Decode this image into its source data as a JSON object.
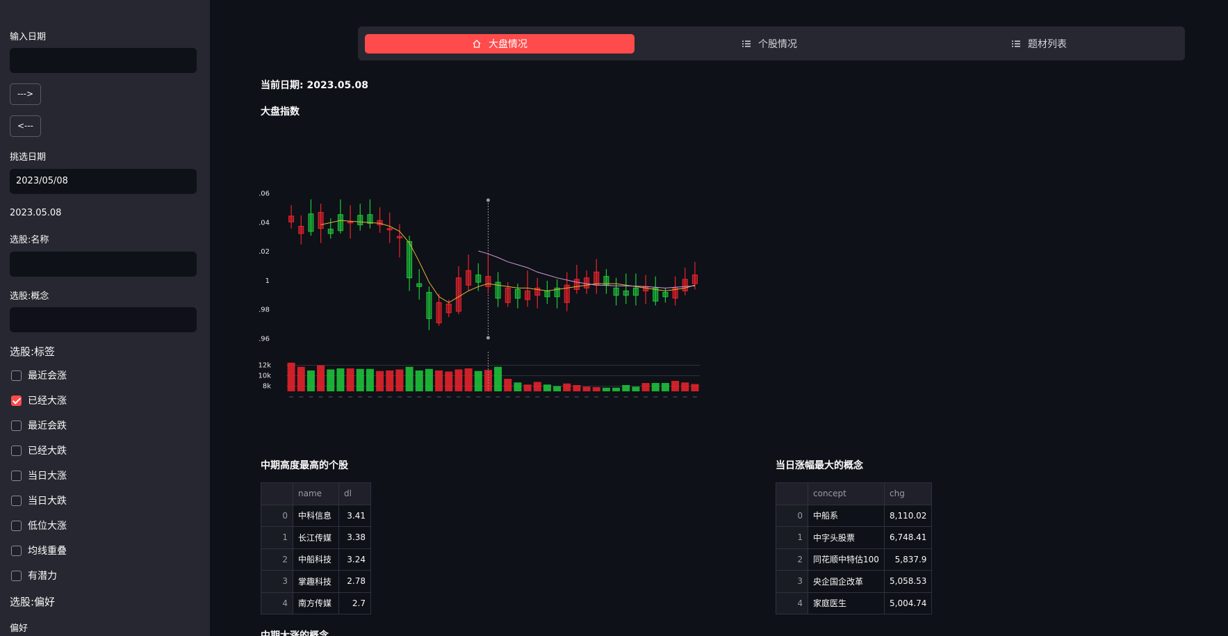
{
  "sidebar": {
    "input_date_label": "输入日期",
    "input_date_value": "",
    "next_label": "--->",
    "prev_label": "<---",
    "pick_date_label": "挑选日期",
    "pick_date_value": "2023/05/08",
    "date_display": "2023.05.08",
    "name_label": "选股:名称",
    "name_value": "",
    "concept_label": "选股:概念",
    "concept_value": "",
    "tag_label": "选股:标签",
    "checkboxes": [
      {
        "label": "最近会涨",
        "checked": false
      },
      {
        "label": "已经大涨",
        "checked": true
      },
      {
        "label": "最近会跌",
        "checked": false
      },
      {
        "label": "已经大跌",
        "checked": false
      },
      {
        "label": "当日大涨",
        "checked": false
      },
      {
        "label": "当日大跌",
        "checked": false
      },
      {
        "label": "低位大涨",
        "checked": false
      },
      {
        "label": "均线重叠",
        "checked": false
      },
      {
        "label": "有潜力",
        "checked": false
      }
    ],
    "pref_label": "选股:偏好",
    "pref_sub_label": "偏好"
  },
  "nav": {
    "tabs": [
      {
        "label": "大盘情况",
        "icon": "home-icon",
        "active": true
      },
      {
        "label": "个股情况",
        "icon": "list-icon",
        "active": false
      },
      {
        "label": "题材列表",
        "icon": "list-icon",
        "active": false
      }
    ]
  },
  "main": {
    "current_date": "当前日期: 2023.05.08",
    "index_title": "大盘指数",
    "stocks_title": "中期高度最高的个股",
    "concepts_title": "当日涨幅最大的概念",
    "bottom_title": "中期大涨的概念"
  },
  "stocks_table": {
    "columns": [
      "",
      "name",
      "dl"
    ],
    "rows": [
      [
        "0",
        "中科信息",
        "3.41"
      ],
      [
        "1",
        "长江传媒",
        "3.38"
      ],
      [
        "2",
        "中船科技",
        "3.24"
      ],
      [
        "3",
        "掌趣科技",
        "2.78"
      ],
      [
        "4",
        "南方传媒",
        "2.7"
      ]
    ]
  },
  "concepts_table": {
    "columns": [
      "",
      "concept",
      "chg"
    ],
    "rows": [
      [
        "0",
        "中船系",
        "8,110.02"
      ],
      [
        "1",
        "中字头股票",
        "6,748.41"
      ],
      [
        "2",
        "同花顺中特估100",
        "5,837.9"
      ],
      [
        "3",
        "央企国企改革",
        "5,058.53"
      ],
      [
        "4",
        "家庭医生",
        "5,004.74"
      ]
    ]
  },
  "colors": {
    "accent": "#ff4b4b",
    "up": "#f0232d",
    "down": "#1ecb3c",
    "ma_fast": "#e6b43c",
    "ma_slow": "#d39ad8"
  },
  "chart_data": {
    "type": "candlestick",
    "title": "",
    "ylim": [
      0.955,
      1.065
    ],
    "yticks": [
      "1.06",
      "1.04",
      "1.02",
      "1",
      "0.98",
      "0.96"
    ],
    "volume_ticks": [
      "12k",
      "10k",
      "8k"
    ],
    "volume_ylim": [
      7000,
      13000
    ],
    "candles": [
      {
        "o": 1.0405,
        "c": 1.0445,
        "h": 1.052,
        "l": 1.036,
        "v": 12500
      },
      {
        "o": 1.0325,
        "c": 1.0375,
        "h": 1.045,
        "l": 1.025,
        "v": 11700
      },
      {
        "o": 1.046,
        "c": 1.034,
        "h": 1.056,
        "l": 1.031,
        "v": 11000
      },
      {
        "o": 1.036,
        "c": 1.047,
        "h": 1.053,
        "l": 1.026,
        "v": 12000
      },
      {
        "o": 1.0355,
        "c": 1.0325,
        "h": 1.043,
        "l": 1.029,
        "v": 11200
      },
      {
        "o": 1.0455,
        "c": 1.0345,
        "h": 1.056,
        "l": 1.0325,
        "v": 11400
      },
      {
        "o": 1.04,
        "c": 1.0405,
        "h": 1.052,
        "l": 1.029,
        "v": 11400
      },
      {
        "o": 1.045,
        "c": 1.0385,
        "h": 1.053,
        "l": 1.0345,
        "v": 11300
      },
      {
        "o": 1.0455,
        "c": 1.0395,
        "h": 1.056,
        "l": 1.036,
        "v": 11300
      },
      {
        "o": 1.0385,
        "c": 1.0415,
        "h": 1.0505,
        "l": 1.033,
        "v": 10900
      },
      {
        "o": 1.035,
        "c": 1.036,
        "h": 1.047,
        "l": 1.026,
        "v": 11000
      },
      {
        "o": 1.0295,
        "c": 1.0305,
        "h": 1.039,
        "l": 1.016,
        "v": 11200
      },
      {
        "o": 1.027,
        "c": 1.002,
        "h": 1.031,
        "l": 0.993,
        "v": 11700
      },
      {
        "o": 0.998,
        "c": 0.996,
        "h": 1.008,
        "l": 0.987,
        "v": 11000
      },
      {
        "o": 0.992,
        "c": 0.974,
        "h": 0.996,
        "l": 0.966,
        "v": 11300
      },
      {
        "o": 0.971,
        "c": 0.985,
        "h": 0.991,
        "l": 0.969,
        "v": 11000
      },
      {
        "o": 0.978,
        "c": 0.984,
        "h": 0.987,
        "l": 0.975,
        "v": 10800
      },
      {
        "o": 0.979,
        "c": 1.002,
        "h": 1.01,
        "l": 0.977,
        "v": 11200
      },
      {
        "o": 0.997,
        "c": 1.007,
        "h": 1.018,
        "l": 0.993,
        "v": 11400
      },
      {
        "o": 1.004,
        "c": 0.999,
        "h": 1.012,
        "l": 0.993,
        "v": 10900
      },
      {
        "o": 0.996,
        "c": 1.003,
        "h": 1.018,
        "l": 0.991,
        "v": 11100
      },
      {
        "o": 0.999,
        "c": 0.988,
        "h": 1.006,
        "l": 0.982,
        "v": 11700
      },
      {
        "o": 0.985,
        "c": 0.995,
        "h": 0.999,
        "l": 0.982,
        "v": 9400
      },
      {
        "o": 0.994,
        "c": 0.988,
        "h": 0.998,
        "l": 0.981,
        "v": 8700
      },
      {
        "o": 0.987,
        "c": 0.993,
        "h": 1.007,
        "l": 0.982,
        "v": 8300
      },
      {
        "o": 0.99,
        "c": 0.995,
        "h": 1.002,
        "l": 0.981,
        "v": 8800
      },
      {
        "o": 0.993,
        "c": 0.989,
        "h": 1.0,
        "l": 0.984,
        "v": 8300
      },
      {
        "o": 0.995,
        "c": 0.989,
        "h": 1.001,
        "l": 0.981,
        "v": 8000
      },
      {
        "o": 0.985,
        "c": 0.997,
        "h": 1.006,
        "l": 0.979,
        "v": 8500
      },
      {
        "o": 0.994,
        "c": 1.001,
        "h": 1.011,
        "l": 0.991,
        "v": 8200
      },
      {
        "o": 0.995,
        "c": 1.002,
        "h": 1.007,
        "l": 0.991,
        "v": 7900
      },
      {
        "o": 0.997,
        "c": 1.006,
        "h": 1.015,
        "l": 0.991,
        "v": 7800
      },
      {
        "o": 1.003,
        "c": 0.997,
        "h": 1.008,
        "l": 0.991,
        "v": 7700
      },
      {
        "o": 0.995,
        "c": 0.99,
        "h": 1.002,
        "l": 0.983,
        "v": 7700
      },
      {
        "o": 0.993,
        "c": 0.99,
        "h": 1.005,
        "l": 0.984,
        "v": 8200
      },
      {
        "o": 0.995,
        "c": 0.99,
        "h": 1.005,
        "l": 0.983,
        "v": 7900
      },
      {
        "o": 0.993,
        "c": 0.996,
        "h": 1.004,
        "l": 0.984,
        "v": 8600
      },
      {
        "o": 0.995,
        "c": 0.986,
        "h": 1.003,
        "l": 0.983,
        "v": 8600
      },
      {
        "o": 0.992,
        "c": 0.989,
        "h": 0.995,
        "l": 0.985,
        "v": 8600
      },
      {
        "o": 0.988,
        "c": 0.995,
        "h": 1.003,
        "l": 0.983,
        "v": 9000
      },
      {
        "o": 0.993,
        "c": 1.001,
        "h": 1.009,
        "l": 0.99,
        "v": 8700
      },
      {
        "o": 0.998,
        "c": 1.004,
        "h": 1.013,
        "l": 0.994,
        "v": 8400
      }
    ],
    "ma_fast": [
      null,
      null,
      null,
      1.0385,
      1.04,
      1.0415,
      1.041,
      1.0405,
      1.04,
      1.0395,
      1.0375,
      1.034,
      1.026,
      1.013,
      0.999,
      0.989,
      0.985,
      0.989,
      0.993,
      0.996,
      0.998,
      0.997,
      0.996,
      0.995,
      0.995,
      0.994,
      0.993,
      0.994,
      0.995,
      0.996,
      0.997,
      0.998,
      0.998,
      0.998,
      0.997,
      0.996,
      0.995,
      0.994,
      0.993,
      0.994,
      0.995,
      0.997
    ],
    "ma_slow": [
      null,
      null,
      null,
      null,
      null,
      null,
      null,
      null,
      null,
      null,
      null,
      null,
      null,
      null,
      null,
      null,
      null,
      null,
      null,
      1.0205,
      1.0185,
      1.016,
      1.013,
      1.011,
      1.009,
      1.006,
      1.004,
      1.002,
      1.0005,
      0.999,
      0.998,
      0.997,
      0.9968,
      0.9965,
      0.9965,
      0.9963,
      0.996,
      0.9955,
      0.995,
      0.9955,
      0.996,
      0.9965
    ]
  }
}
